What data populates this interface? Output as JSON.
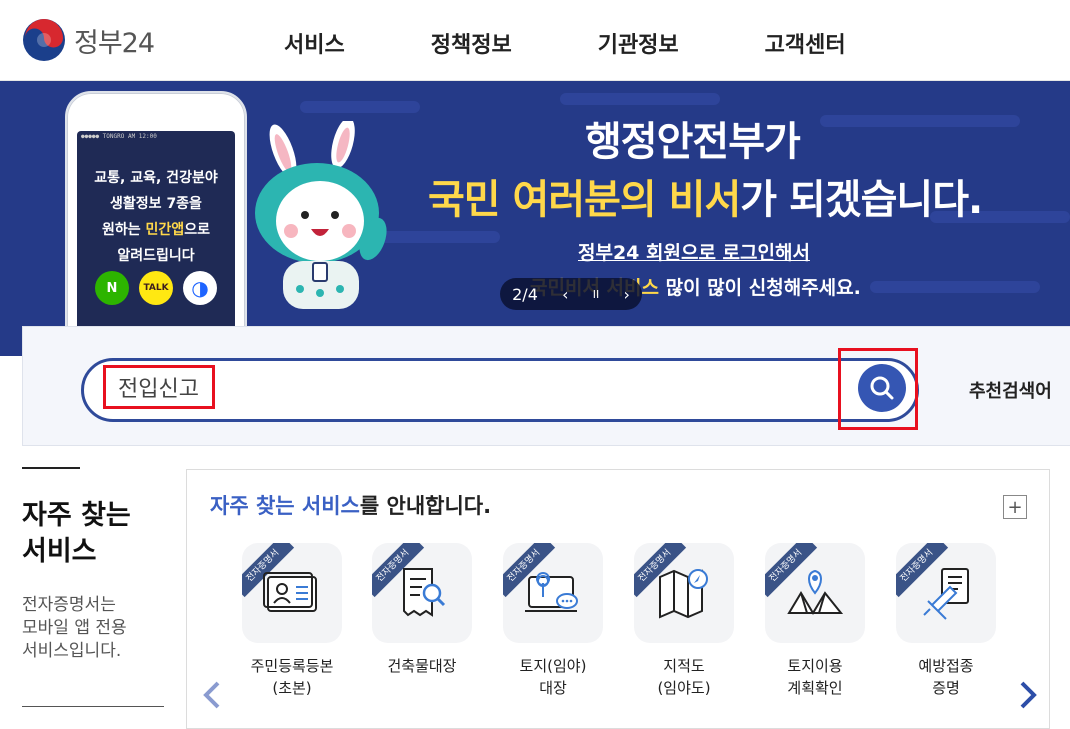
{
  "header": {
    "logo_text": "정부24",
    "nav": [
      "서비스",
      "정책정보",
      "기관정보",
      "고객센터"
    ]
  },
  "banner": {
    "phone_status": "●●●●● TONGRO   AM 12:00",
    "phone_lines": [
      "교통, 교육, 건강분야",
      "생활정보 7종을",
      "원하는 ",
      "민간앱",
      "으로",
      "알려드립니다"
    ],
    "app_icons": [
      "N",
      "TALK",
      "◑"
    ],
    "title": "행정안전부가",
    "line2_hl": "국민 여러분의 비서",
    "line2_rest": "가 되겠습니다.",
    "sub1": "정부24 회원으로 로그인해서",
    "sub2_hl": "국민비서 서비스",
    "sub2_rest": " 많이 많이 신청해주세요.",
    "pager": {
      "current": "2",
      "sep": "/",
      "total": "4",
      "prev": "‹",
      "pause": "II",
      "next": "›"
    }
  },
  "search": {
    "value": "전입신고",
    "recommend_label": "추천검색어"
  },
  "left": {
    "title_line1": "자주 찾는",
    "title_line2": "서비스",
    "desc_line1": "전자증명서는",
    "desc_line2": "모바일 앱 전용",
    "desc_line3": "서비스입니다."
  },
  "panel": {
    "title_hl": "자주 찾는 서비스",
    "title_rest": "를 안내합니다.",
    "plus": "+",
    "ribbon": "전자증명서",
    "services": [
      {
        "line1": "주민등록등본",
        "line2": "(초본)",
        "icon": "id-card-icon"
      },
      {
        "line1": "건축물대장",
        "line2": "",
        "icon": "document-search-icon"
      },
      {
        "line1": "토지(임야)",
        "line2": "대장",
        "icon": "land-register-icon"
      },
      {
        "line1": "지적도",
        "line2": "(임야도)",
        "icon": "map-compass-icon"
      },
      {
        "line1": "토지이용",
        "line2": "계획확인",
        "icon": "map-pin-icon"
      },
      {
        "line1": "예방접종",
        "line2": "증명",
        "icon": "syringe-icon"
      }
    ]
  }
}
